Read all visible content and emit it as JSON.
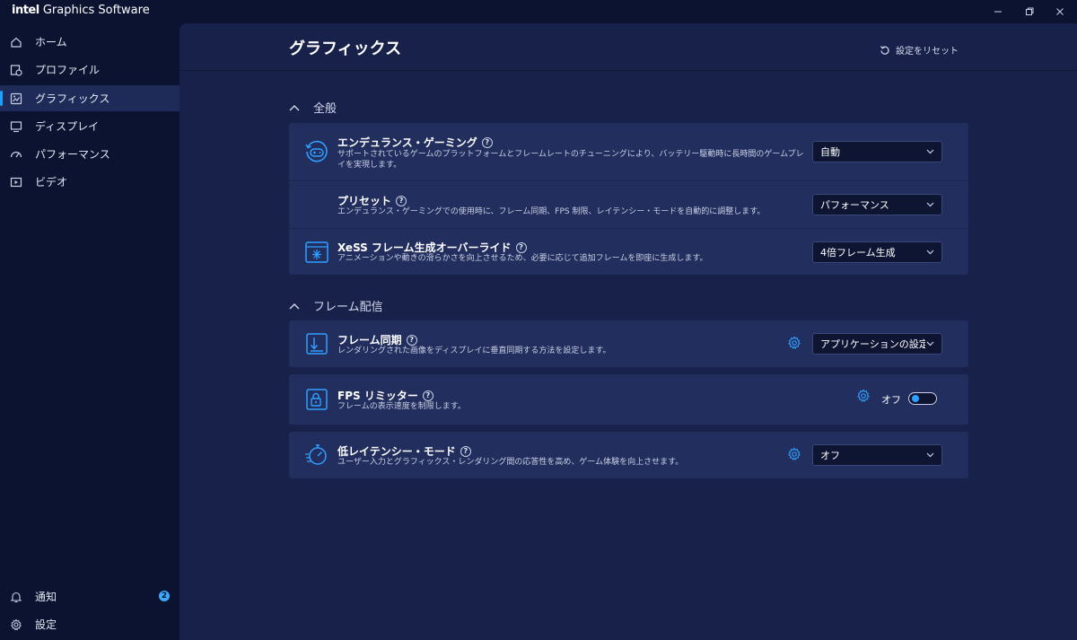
{
  "app": {
    "brand": "intel",
    "title_rest": "Graphics Software"
  },
  "window": {
    "minimize": "—",
    "maximize": "▢",
    "close": "✕"
  },
  "sidebar": {
    "items": [
      {
        "label": "ホーム",
        "icon": "home-icon"
      },
      {
        "label": "プロファイル",
        "icon": "profile-icon"
      },
      {
        "label": "グラフィックス",
        "icon": "graphics-icon",
        "active": true
      },
      {
        "label": "ディスプレイ",
        "icon": "display-icon"
      },
      {
        "label": "パフォーマンス",
        "icon": "performance-icon"
      },
      {
        "label": "ビデオ",
        "icon": "video-icon"
      }
    ],
    "bottom": [
      {
        "label": "通知",
        "icon": "bell-icon",
        "badge": "2"
      },
      {
        "label": "設定",
        "icon": "gear-icon"
      }
    ]
  },
  "header": {
    "title": "グラフィックス",
    "reset_label": "設定をリセット"
  },
  "sections": {
    "general": {
      "title": "全般",
      "rows": [
        {
          "title": "エンデュランス・ゲーミング",
          "help": "?",
          "desc": "サポートされているゲームのプラットフォームとフレームレートのチューニングにより、バッテリー駆動時に長時間のゲームプレイを実現します。",
          "value": "自動"
        },
        {
          "title": "プリセット",
          "help": "?",
          "desc": "エンデュランス・ゲーミングでの使用時に、フレーム同期、FPS 制限、レイテンシー・モードを自動的に調整します。",
          "value": "パフォーマンス"
        },
        {
          "title": "XeSS フレーム生成オーバーライド",
          "help": "?",
          "desc": "アニメーションや動きの滑らかさを向上させるため、必要に応じて追加フレームを即座に生成します。",
          "value": "4倍フレーム生成"
        }
      ]
    },
    "frame_delivery": {
      "title": "フレーム配信",
      "rows": [
        {
          "title": "フレーム同期",
          "help": "?",
          "desc": "レンダリングされた画像をディスプレイに垂直同期する方法を設定します。",
          "value": "アプリケーションの設定"
        },
        {
          "title": "FPS リミッター",
          "help": "?",
          "desc": "フレームの表示速度を制限します。",
          "toggle_label": "オフ",
          "toggle_on": false
        },
        {
          "title": "低レイテンシー・モード",
          "help": "?",
          "desc": "ユーザー入力とグラフィックス・レンダリング間の応答性を高め、ゲーム体験を向上させます。",
          "value": "オフ"
        }
      ]
    }
  },
  "colors": {
    "accent": "#1ea0ff",
    "background": "#0c1330",
    "panel": "#18214a",
    "card": "#222e5e"
  }
}
